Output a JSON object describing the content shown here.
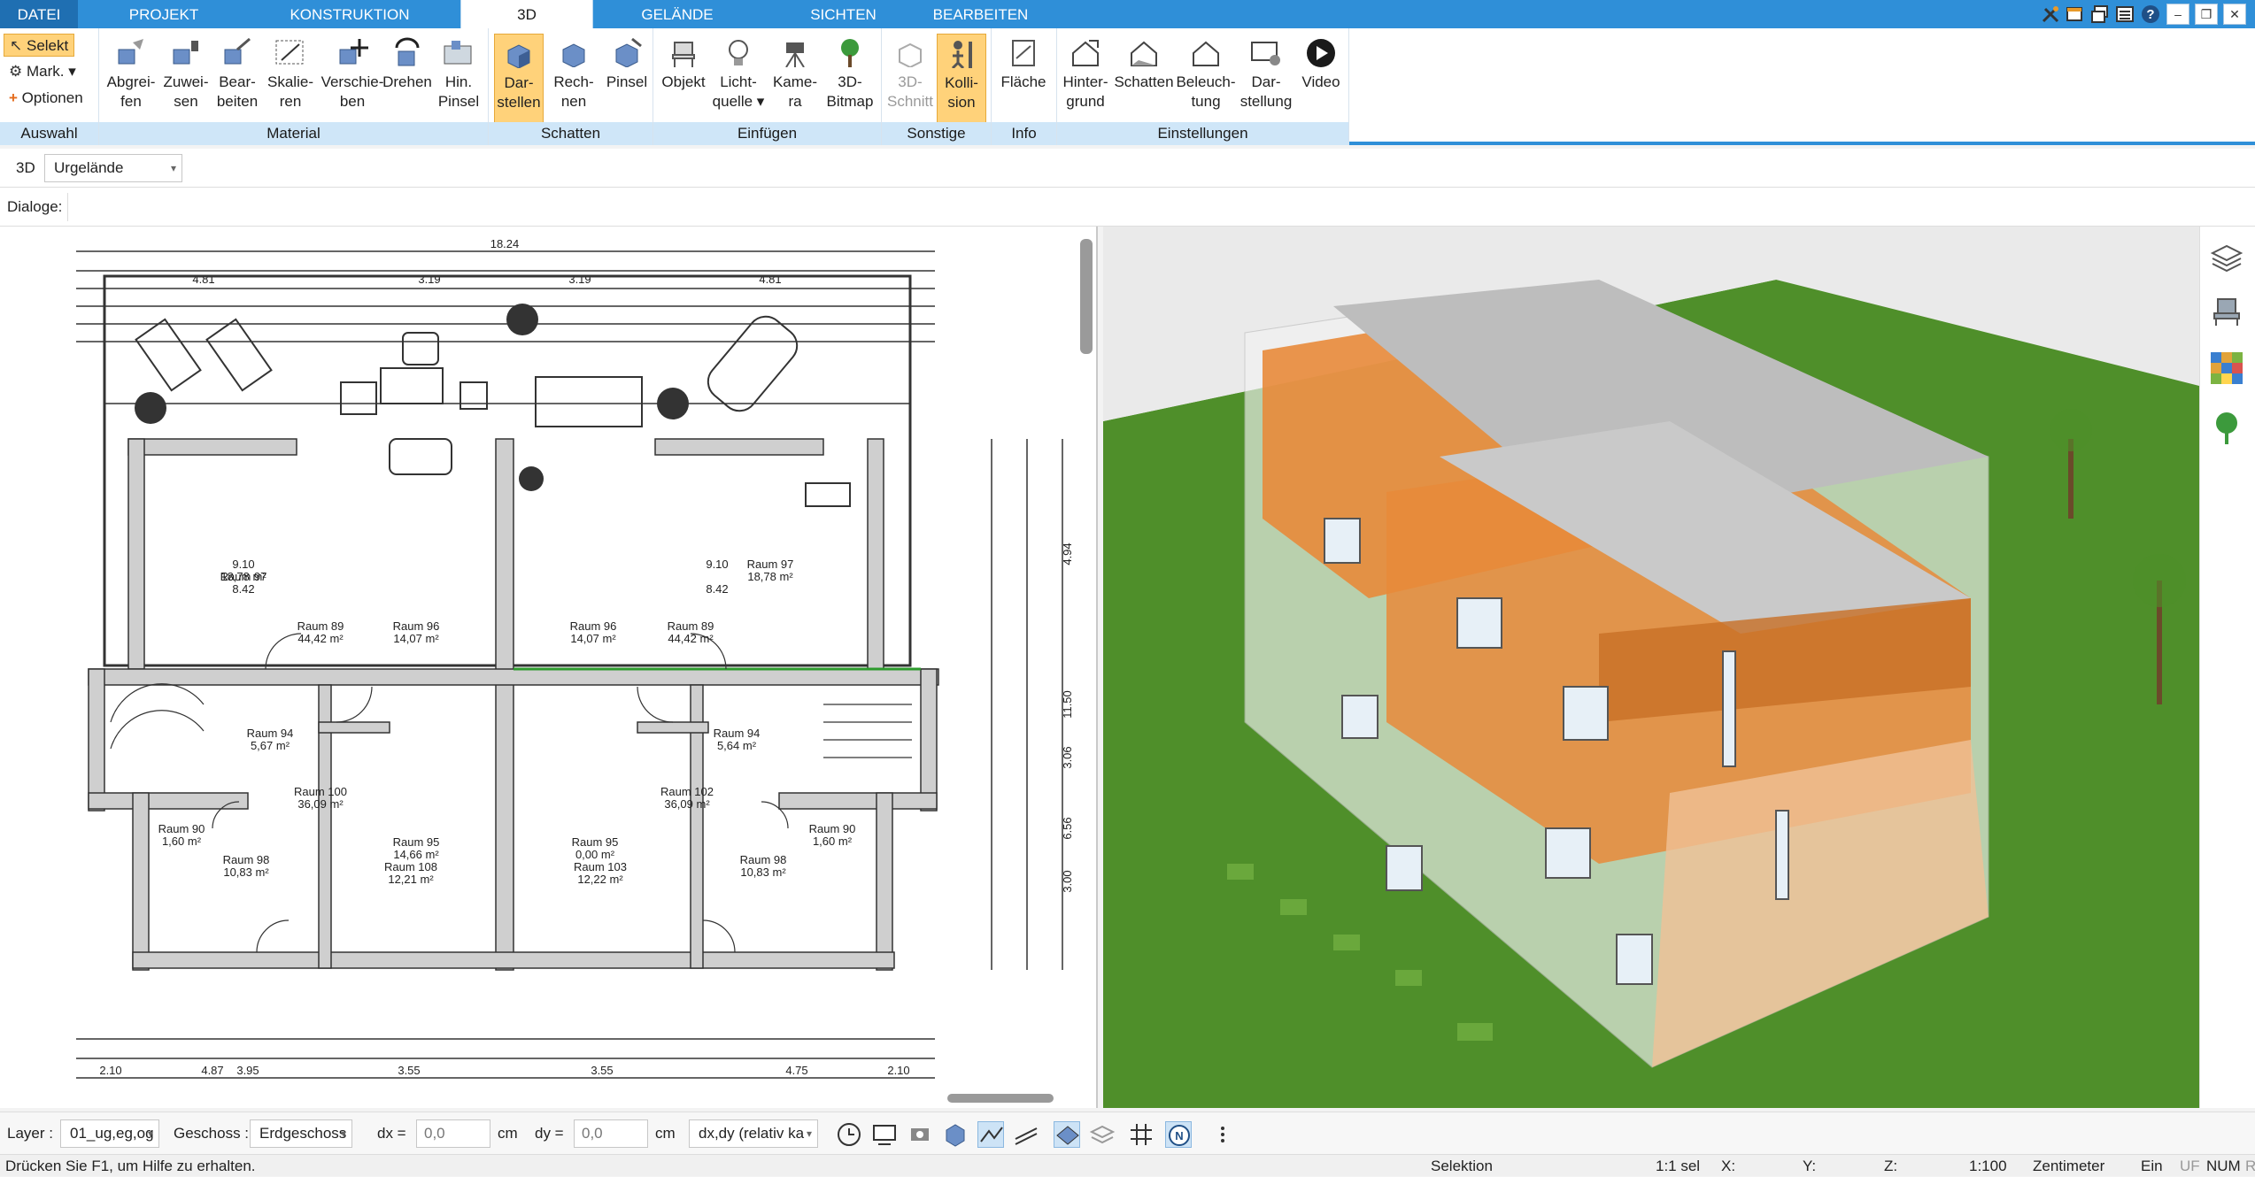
{
  "tabs": [
    "DATEI",
    "PROJEKT",
    "KONSTRUKTION",
    "3D",
    "GELÄNDE",
    "SICHTEN",
    "BEARBEITEN"
  ],
  "auswahl": {
    "selekt": "Selekt",
    "mark": "Mark.",
    "optionen": "Optionen",
    "label": "Auswahl"
  },
  "material": {
    "label": "Material",
    "buttons": [
      {
        "l1": "Abgrei-",
        "l2": "fen"
      },
      {
        "l1": "Zuwei-",
        "l2": "sen"
      },
      {
        "l1": "Bear-",
        "l2": "beiten"
      },
      {
        "l1": "Skalie-",
        "l2": "ren"
      },
      {
        "l1": "Verschie-",
        "l2": "ben"
      },
      {
        "l1": "Drehen",
        "l2": ""
      },
      {
        "l1": "Hin.",
        "l2": "Pinsel"
      }
    ]
  },
  "schatten": {
    "label": "Schatten",
    "buttons": [
      {
        "l1": "Dar-",
        "l2": "stellen"
      },
      {
        "l1": "Rech-",
        "l2": "nen"
      },
      {
        "l1": "Pinsel",
        "l2": ""
      }
    ]
  },
  "einfuegen": {
    "label": "Einfügen",
    "buttons": [
      {
        "l1": "Objekt",
        "l2": ""
      },
      {
        "l1": "Licht-",
        "l2": "quelle"
      },
      {
        "l1": "Kame-",
        "l2": "ra"
      },
      {
        "l1": "3D-",
        "l2": "Bitmap"
      }
    ]
  },
  "sonstige": {
    "label": "Sonstige",
    "buttons": [
      {
        "l1": "3D-",
        "l2": "Schnitt"
      },
      {
        "l1": "Kolli-",
        "l2": "sion"
      }
    ]
  },
  "info": {
    "label": "Info",
    "buttons": [
      {
        "l1": "Fläche",
        "l2": ""
      }
    ]
  },
  "einstellungen": {
    "label": "Einstellungen",
    "buttons": [
      {
        "l1": "Hinter-",
        "l2": "grund"
      },
      {
        "l1": "Schatten",
        "l2": ""
      },
      {
        "l1": "Beleuch-",
        "l2": "tung"
      },
      {
        "l1": "Dar-",
        "l2": "stellung"
      },
      {
        "l1": "Video",
        "l2": ""
      }
    ]
  },
  "view_row": {
    "prefix": "3D",
    "mode": "Urgelände"
  },
  "dialog_row": {
    "label": "Dialoge:"
  },
  "plan": {
    "total_width": "18.24",
    "rooms": [
      {
        "name": "Raum 97",
        "area": "18,78 m²"
      },
      {
        "name": "Raum 97",
        "area": "18,78 m²"
      },
      {
        "name": "Raum 89",
        "area": "44,42 m²"
      },
      {
        "name": "Raum 96",
        "area": "14,07 m²"
      },
      {
        "name": "Raum 96",
        "area": "14,07 m²"
      },
      {
        "name": "Raum 89",
        "area": "44,42 m²"
      },
      {
        "name": "Raum 94",
        "area": "5,67 m²"
      },
      {
        "name": "Raum 94",
        "area": "5,64 m²"
      },
      {
        "name": "Raum 100",
        "area": "36,09 m²"
      },
      {
        "name": "Raum 102",
        "area": "36,09 m²"
      },
      {
        "name": "Raum 90",
        "area": "1,60 m²"
      },
      {
        "name": "Raum 90",
        "area": "1,60 m²"
      },
      {
        "name": "Raum 95",
        "area": "14,66 m²"
      },
      {
        "name": "Raum 95",
        "area": "0,00 m²"
      },
      {
        "name": "Raum 108",
        "area": "12,21 m²"
      },
      {
        "name": "Raum 103",
        "area": "12,22 m²"
      },
      {
        "name": "Raum 98",
        "area": "10,83 m²"
      },
      {
        "name": "Raum 98",
        "area": "10,83 m²"
      }
    ],
    "dims_top": [
      "4.81",
      "3.19",
      "3.19",
      "4.81"
    ],
    "dims_side": [
      "9.10",
      "8.42",
      "9.10",
      "8.42"
    ],
    "dims_bottom": [
      "2.10",
      "4.87",
      "3.95",
      "3.55",
      "3.55",
      "4.75",
      "2.10"
    ],
    "dims_right": [
      "4.94",
      "11.50",
      "3.06",
      "6.56",
      "3.00"
    ]
  },
  "status": {
    "layer_label": "Layer :",
    "layer_value": "01_ug,eg,og",
    "geschoss_label": "Geschoss :",
    "geschoss_value": "Erdgeschoss",
    "dx_label": "dx =",
    "dx_value": "0,0",
    "dx_unit": "cm",
    "dy_label": "dy =",
    "dy_value": "0,0",
    "dy_unit": "cm",
    "mode_value": "dx,dy (relativ ka"
  },
  "helpbar": {
    "hint": "Drücken Sie F1, um Hilfe zu erhalten.",
    "mode": "Selektion",
    "sel": "1:1 sel",
    "x": "X:",
    "y": "Y:",
    "z": "Z:",
    "scale": "1:100",
    "unit": "Zentimeter",
    "ein": "Ein",
    "uf": "UF",
    "num": "NUM",
    "r": "R"
  },
  "colors": {
    "accent": "#2f8fd8",
    "ribbon_group": "#cfe6f8",
    "active_btn": "#ffd27a",
    "grass": "#4f8f2a",
    "orange": "#e8893a"
  }
}
